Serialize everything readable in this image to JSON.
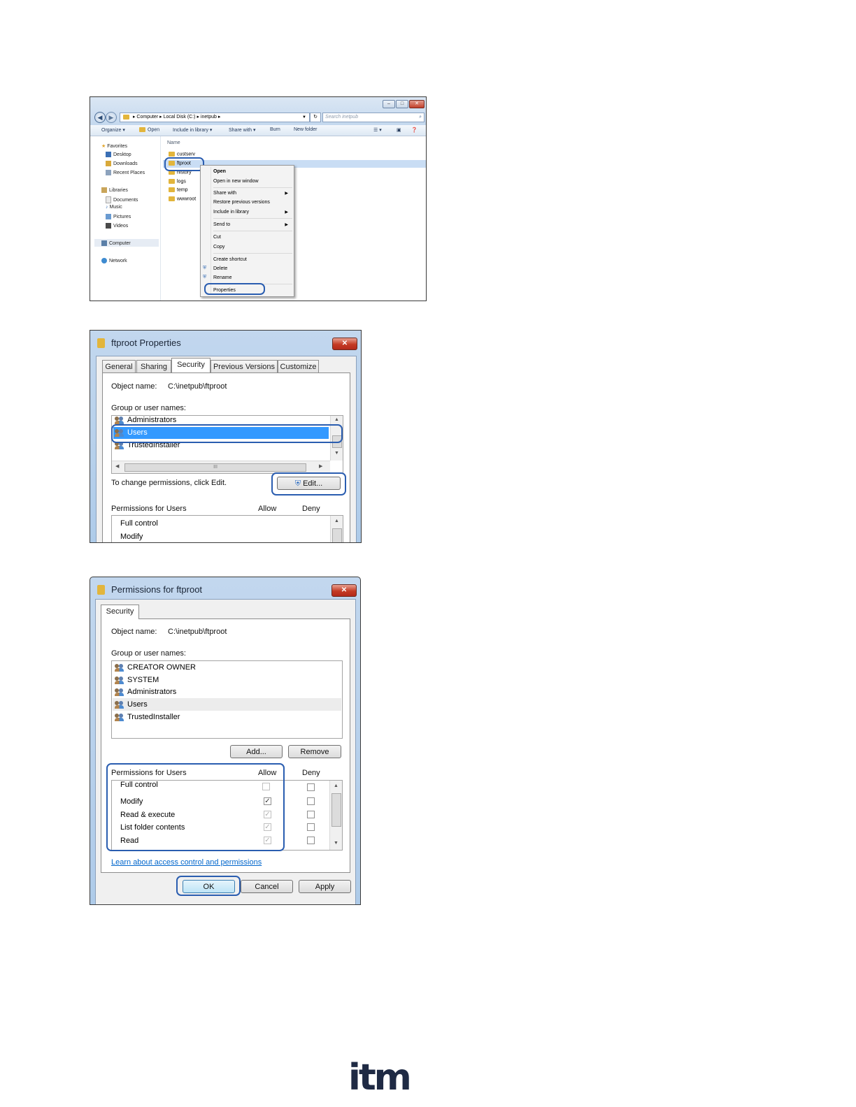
{
  "explorer": {
    "breadcrumb": [
      "Computer",
      "Local Disk (C:)",
      "inetpub"
    ],
    "search_placeholder": "Search inetpub",
    "toolbar": [
      "Organize ▾",
      "Open",
      "Include in library ▾",
      "Share with ▾",
      "Burn",
      "New folder"
    ],
    "column_name": "Name",
    "nav": {
      "favorites": "Favorites",
      "favorites_items": [
        "Desktop",
        "Downloads",
        "Recent Places"
      ],
      "libraries": "Libraries",
      "library_items": [
        "Documents",
        "Music",
        "Pictures",
        "Videos"
      ],
      "computer": "Computer",
      "network": "Network"
    },
    "files": [
      "custserv",
      "ftproot",
      "history",
      "logs",
      "temp",
      "wwwroot"
    ],
    "context_menu": {
      "open": "Open",
      "open_new_window": "Open in new window",
      "share_with": "Share with",
      "restore_previous": "Restore previous versions",
      "include_in_library": "Include in library",
      "send_to": "Send to",
      "cut": "Cut",
      "copy": "Copy",
      "create_shortcut": "Create shortcut",
      "delete": "Delete",
      "rename": "Rename",
      "properties": "Properties"
    }
  },
  "properties": {
    "title": "ftproot Properties",
    "tabs": [
      "General",
      "Sharing",
      "Security",
      "Previous Versions",
      "Customize"
    ],
    "object_name_label": "Object name:",
    "object_name_value": "C:\\inetpub\\ftproot",
    "group_label": "Group or user names:",
    "groups": [
      "Administrators",
      "Users",
      "TrustedInstaller"
    ],
    "change_text": "To change permissions, click Edit.",
    "edit_button": "Edit...",
    "permissions_label": "Permissions for Users",
    "allow": "Allow",
    "deny": "Deny",
    "perm_rows": [
      "Full control",
      "Modify"
    ],
    "close": "✕"
  },
  "permissions": {
    "title": "Permissions for ftproot",
    "tab": "Security",
    "object_name_label": "Object name:",
    "object_name_value": "C:\\inetpub\\ftproot",
    "group_label": "Group or user names:",
    "groups": [
      "CREATOR OWNER",
      "SYSTEM",
      "Administrators",
      "Users",
      "TrustedInstaller"
    ],
    "add_button": "Add...",
    "remove_button": "Remove",
    "permissions_label": "Permissions for Users",
    "allow": "Allow",
    "deny": "Deny",
    "perm_rows": [
      {
        "name": "Full control",
        "allow": false,
        "deny": false
      },
      {
        "name": "Modify",
        "allow": true,
        "deny": false
      },
      {
        "name": "Read & execute",
        "allow": true,
        "deny": false
      },
      {
        "name": "List folder contents",
        "allow": true,
        "deny": false
      },
      {
        "name": "Read",
        "allow": true,
        "deny": false
      }
    ],
    "learn_link": "Learn about access control and permissions",
    "ok_button": "OK",
    "cancel_button": "Cancel",
    "apply_button": "Apply",
    "close": "✕"
  },
  "footer_logo": "itm"
}
